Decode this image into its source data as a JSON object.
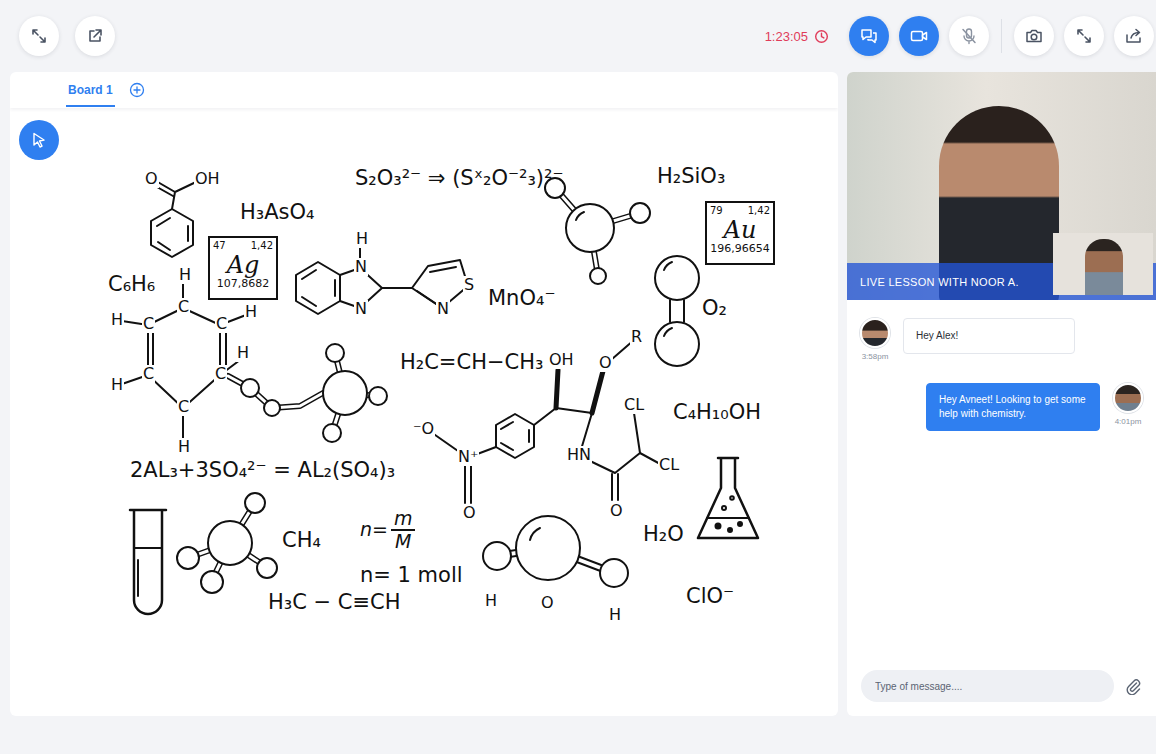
{
  "toolbar": {
    "timer": "1:23:05",
    "chat_active": true,
    "video_active": true,
    "mic_muted": true
  },
  "tabs": [
    {
      "label": "Board 1",
      "selected": true
    }
  ],
  "tools": {
    "pointer_selected": true
  },
  "board": {
    "items": [
      {
        "kind": "formula",
        "text": "S₂O₃²⁻ ⇒ (Sˣ₂O⁻²₃)²⁻"
      },
      {
        "kind": "formula",
        "text": "H₂SiO₃"
      },
      {
        "kind": "formula",
        "text": "H₃AsO₄"
      },
      {
        "kind": "element",
        "number": "47",
        "value": "1,42",
        "symbol": "Ag",
        "mass": "107,8682"
      },
      {
        "kind": "element",
        "number": "79",
        "value": "1,42",
        "symbol": "Au",
        "mass": "196,96654"
      },
      {
        "kind": "formula",
        "text": "MnO₄⁻"
      },
      {
        "kind": "formula",
        "text": "O₂"
      },
      {
        "kind": "formula",
        "text": "C₆H₆"
      },
      {
        "kind": "formula",
        "text": "H₂C=CH−CH₃"
      },
      {
        "kind": "formula",
        "text": "C₄H₁₀OH"
      },
      {
        "kind": "formula",
        "text": "2AL₃+3SO₄²⁻ = AL₂(SO₄)₃"
      },
      {
        "kind": "formula",
        "text": "CH₄"
      },
      {
        "kind": "fraction",
        "lhs": "n=",
        "num": "m",
        "den": "M"
      },
      {
        "kind": "formula",
        "text": "n= 1 moll"
      },
      {
        "kind": "formula",
        "text": "H₃C − C≡CH"
      },
      {
        "kind": "formula",
        "text": "H₂O"
      },
      {
        "kind": "formula",
        "text": "ClO⁻"
      },
      {
        "kind": "atom",
        "text": "O"
      },
      {
        "kind": "atom",
        "text": "OH"
      },
      {
        "kind": "atom",
        "text": "H"
      },
      {
        "kind": "atom",
        "text": "N"
      },
      {
        "kind": "atom",
        "text": "N"
      },
      {
        "kind": "atom",
        "text": "N"
      },
      {
        "kind": "atom",
        "text": "S"
      },
      {
        "kind": "atom",
        "text": "H"
      },
      {
        "kind": "atom",
        "text": "H"
      },
      {
        "kind": "atom",
        "text": "C"
      },
      {
        "kind": "atom",
        "text": "C"
      },
      {
        "kind": "atom",
        "text": "C"
      },
      {
        "kind": "atom",
        "text": "H"
      },
      {
        "kind": "atom",
        "text": "C"
      },
      {
        "kind": "atom",
        "text": "H"
      },
      {
        "kind": "atom",
        "text": "C"
      },
      {
        "kind": "atom",
        "text": "H"
      },
      {
        "kind": "atom",
        "text": "C"
      },
      {
        "kind": "atom",
        "text": "H"
      },
      {
        "kind": "atom",
        "text": "OH"
      },
      {
        "kind": "atom",
        "text": "O"
      },
      {
        "kind": "atom",
        "text": "R"
      },
      {
        "kind": "atom",
        "text": "⁻O"
      },
      {
        "kind": "atom",
        "text": "N⁺"
      },
      {
        "kind": "atom",
        "text": "O"
      },
      {
        "kind": "atom",
        "text": "HN"
      },
      {
        "kind": "atom",
        "text": "CL"
      },
      {
        "kind": "atom",
        "text": "CL"
      },
      {
        "kind": "atom",
        "text": "O"
      },
      {
        "kind": "atom",
        "text": "H"
      },
      {
        "kind": "atom",
        "text": "O"
      },
      {
        "kind": "atom",
        "text": "H"
      }
    ]
  },
  "video": {
    "caption": "LIVE LESSON WITH NOOR A."
  },
  "chat": {
    "messages": [
      {
        "text": "Hey Alex!",
        "time": "3:58pm",
        "outgoing": false
      },
      {
        "text": "Hey Avneet! Looking to get some help with chemistry.",
        "time": "4:01pm",
        "outgoing": true
      }
    ],
    "input": {
      "placeholder": "Type of message...."
    }
  }
}
